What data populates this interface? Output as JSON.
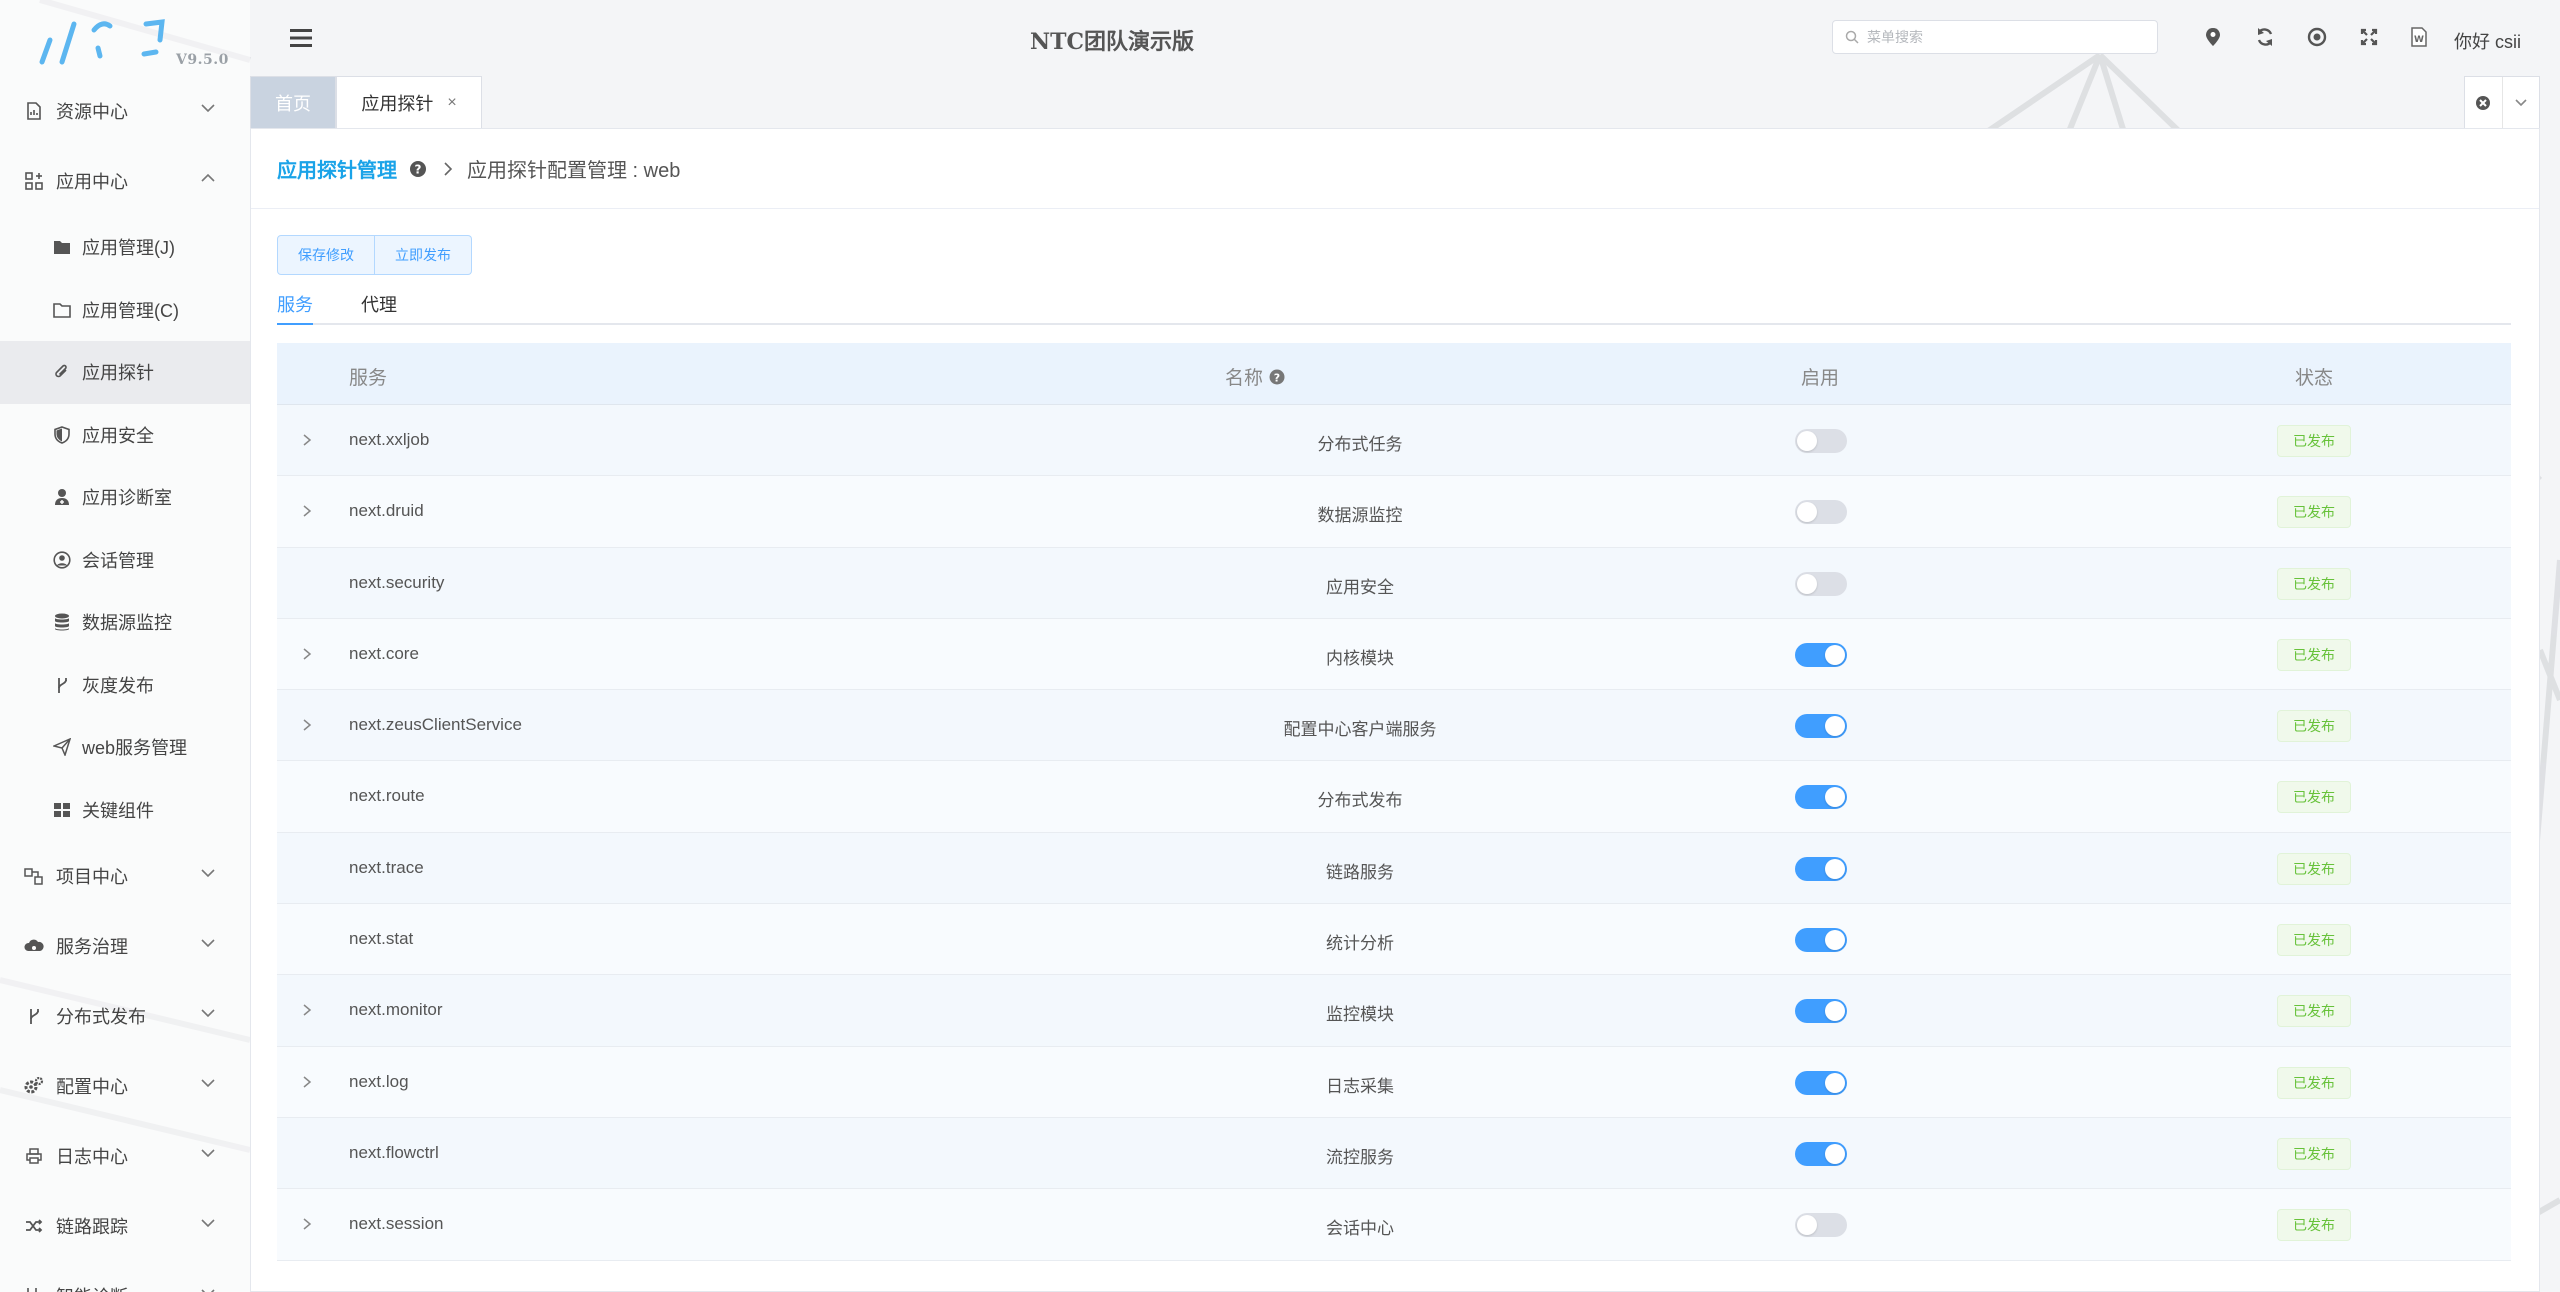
{
  "header": {
    "title": "NTC团队演示版",
    "search_placeholder": "菜单搜索",
    "greeting": "你好 csii"
  },
  "logo": {
    "version": "V9.5.0"
  },
  "sidebar": {
    "groups_top": [
      {
        "label": "资源中心",
        "icon": "file-chart-icon",
        "expanded": false
      },
      {
        "label": "应用中心",
        "icon": "grid-plus-icon",
        "expanded": true
      }
    ],
    "app_items": [
      {
        "label": "应用管理(J)",
        "icon": "folder-filled-icon",
        "active": false
      },
      {
        "label": "应用管理(C)",
        "icon": "folder-outline-icon",
        "active": false
      },
      {
        "label": "应用探针",
        "icon": "paperclip-icon",
        "active": true
      },
      {
        "label": "应用安全",
        "icon": "shield-icon",
        "active": false
      },
      {
        "label": "应用诊断室",
        "icon": "user-doctor-icon",
        "active": false
      },
      {
        "label": "会话管理",
        "icon": "user-circle-icon",
        "active": false
      },
      {
        "label": "数据源监控",
        "icon": "database-icon",
        "active": false
      },
      {
        "label": "灰度发布",
        "icon": "branch-icon",
        "active": false
      },
      {
        "label": "web服务管理",
        "icon": "paper-plane-icon",
        "active": false
      },
      {
        "label": "关键组件",
        "icon": "th-large-icon",
        "active": false
      }
    ],
    "groups_bottom": [
      {
        "label": "项目中心",
        "icon": "project-icon"
      },
      {
        "label": "服务治理",
        "icon": "cloud-gear-icon"
      },
      {
        "label": "分布式发布",
        "icon": "branch-icon"
      },
      {
        "label": "配置中心",
        "icon": "cogs-icon"
      },
      {
        "label": "日志中心",
        "icon": "printer-icon"
      },
      {
        "label": "链路跟踪",
        "icon": "random-icon"
      },
      {
        "label": "智能诊断",
        "icon": "stethoscope-icon"
      }
    ]
  },
  "tabs": [
    {
      "label": "首页",
      "closable": false
    },
    {
      "label": "应用探针",
      "closable": true
    }
  ],
  "breadcrumb": {
    "parent": "应用探针管理",
    "current": "应用探针配置管理 : web"
  },
  "actions": {
    "save": "保存修改",
    "publish": "立即发布"
  },
  "sub_tabs": [
    {
      "label": "服务",
      "active": true
    },
    {
      "label": "代理",
      "active": false
    }
  ],
  "table": {
    "columns": {
      "service": "服务",
      "name": "名称",
      "enabled": "启用",
      "status": "状态"
    },
    "rows": [
      {
        "service": "next.xxljob",
        "name": "分布式任务",
        "enabled": false,
        "status": "已发布",
        "expandable": true
      },
      {
        "service": "next.druid",
        "name": "数据源监控",
        "enabled": false,
        "status": "已发布",
        "expandable": true
      },
      {
        "service": "next.security",
        "name": "应用安全",
        "enabled": false,
        "status": "已发布",
        "expandable": false
      },
      {
        "service": "next.core",
        "name": "内核模块",
        "enabled": true,
        "status": "已发布",
        "expandable": true
      },
      {
        "service": "next.zeusClientService",
        "name": "配置中心客户端服务",
        "enabled": true,
        "status": "已发布",
        "expandable": true
      },
      {
        "service": "next.route",
        "name": "分布式发布",
        "enabled": true,
        "status": "已发布",
        "expandable": false
      },
      {
        "service": "next.trace",
        "name": "链路服务",
        "enabled": true,
        "status": "已发布",
        "expandable": false
      },
      {
        "service": "next.stat",
        "name": "统计分析",
        "enabled": true,
        "status": "已发布",
        "expandable": false
      },
      {
        "service": "next.monitor",
        "name": "监控模块",
        "enabled": true,
        "status": "已发布",
        "expandable": true
      },
      {
        "service": "next.log",
        "name": "日志采集",
        "enabled": true,
        "status": "已发布",
        "expandable": true
      },
      {
        "service": "next.flowctrl",
        "name": "流控服务",
        "enabled": true,
        "status": "已发布",
        "expandable": false
      },
      {
        "service": "next.session",
        "name": "会话中心",
        "enabled": false,
        "status": "已发布",
        "expandable": true
      }
    ]
  },
  "colors": {
    "accent": "#409eff",
    "link": "#1aa3e8",
    "success": "#67c23a",
    "tab_home_bg": "#c9d3e0"
  }
}
